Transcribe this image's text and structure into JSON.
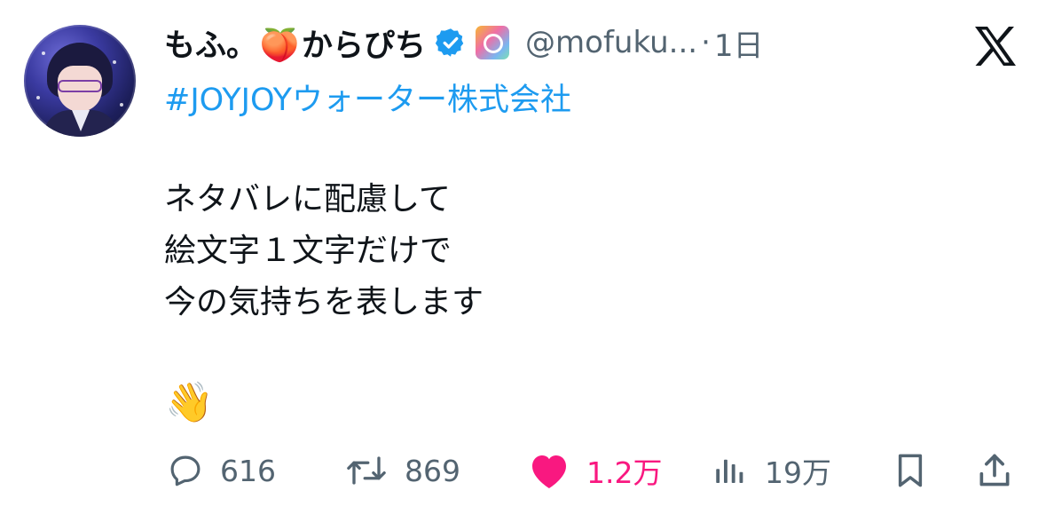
{
  "tweet": {
    "display_name": "もふ。🍑からぴち",
    "display_name_part1": "もふ。",
    "display_name_emoji": "🍑",
    "display_name_part2": "からぴち",
    "handle": "@mofuku...",
    "separator": "·",
    "time": "1日",
    "hashtag": "#JOYJOYウォーター株式会社",
    "body_lines": [
      "ネタバレに配慮して",
      "絵文字１文字だけで",
      "今の気持ちを表します"
    ],
    "emoji": "👋",
    "icons": {
      "verified": "verified-badge-icon",
      "affiliate": "affiliate-badge-icon",
      "platform": "x-logo-icon"
    }
  },
  "actions": {
    "reply_count": "616",
    "retweet_count": "869",
    "like_count": "1.2万",
    "liked": true,
    "views_count": "19万"
  },
  "colors": {
    "link": "#1d9bf0",
    "secondary_text": "#536471",
    "like": "#f91880",
    "verified": "#1d9bf0"
  }
}
